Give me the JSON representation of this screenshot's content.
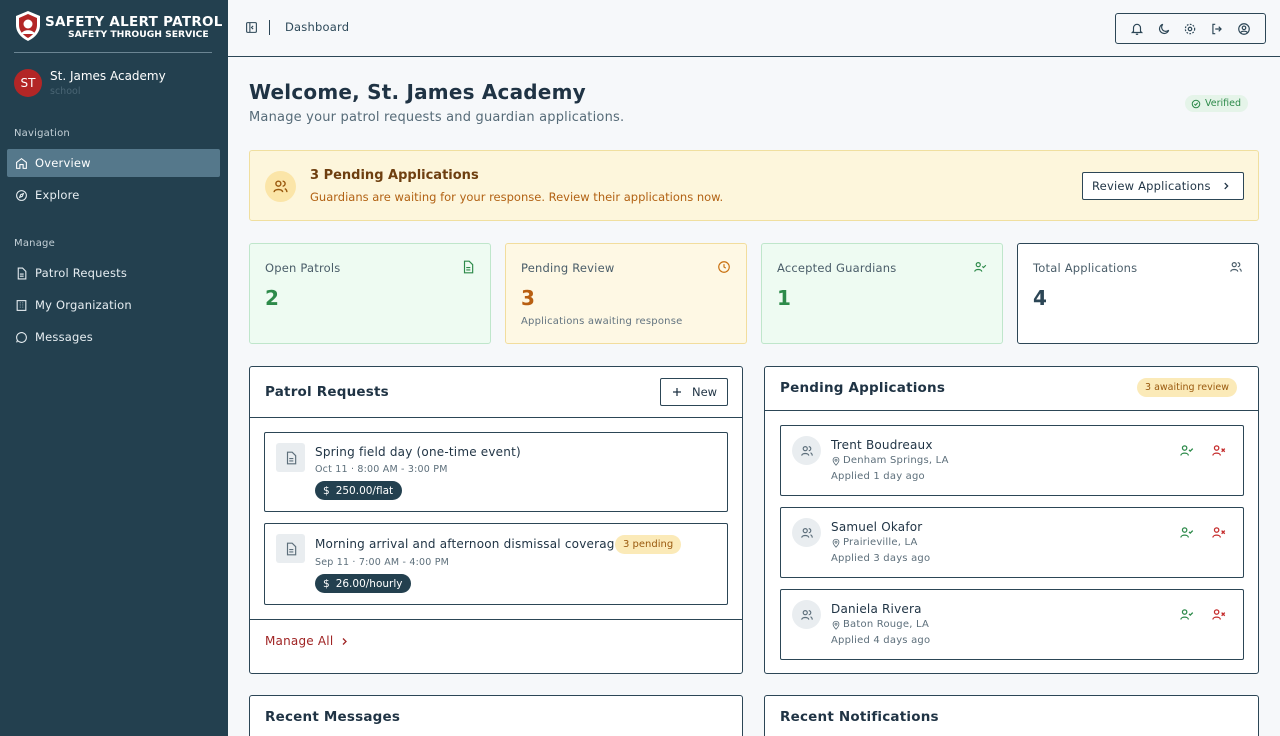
{
  "brand": {
    "title": "SAFETY ALERT PATROL",
    "tagline": "SAFETY THROUGH SERVICE"
  },
  "profile": {
    "initials": "ST",
    "name": "St. James Academy",
    "role": "school"
  },
  "nav": {
    "section1": "Navigation",
    "items1": [
      {
        "label": "Overview",
        "icon": "home-icon",
        "active": true
      },
      {
        "label": "Explore",
        "icon": "compass-icon",
        "active": false
      }
    ],
    "section2": "Manage",
    "items2": [
      {
        "label": "Patrol Requests",
        "icon": "file-text-icon"
      },
      {
        "label": "My Organization",
        "icon": "building-icon"
      },
      {
        "label": "Messages",
        "icon": "message-circle-icon"
      }
    ]
  },
  "topbar": {
    "breadcrumb": "Dashboard",
    "tools": [
      "bell-icon",
      "moon-icon",
      "gear-icon",
      "logout-icon",
      "user-circle-icon"
    ]
  },
  "header": {
    "welcome": "Welcome, St. James Academy",
    "subtitle": "Manage your patrol requests and guardian applications.",
    "badge": "Verified"
  },
  "alert": {
    "title": "3 Pending Applications",
    "text": "Guardians are waiting for your response. Review their applications now.",
    "button": "Review Applications"
  },
  "stats": [
    {
      "label": "Open Patrols",
      "value": "2",
      "sub": "",
      "icon": "file-text-icon",
      "color": "#2d8a4a"
    },
    {
      "label": "Pending Review",
      "value": "3",
      "sub": "Applications awaiting response",
      "icon": "clock-icon",
      "color": "#b85f12"
    },
    {
      "label": "Accepted Guardians",
      "value": "1",
      "sub": "",
      "icon": "user-check-icon",
      "color": "#2d8a4a"
    },
    {
      "label": "Total Applications",
      "value": "4",
      "sub": "",
      "icon": "users-icon",
      "color": "#2c4656"
    }
  ],
  "patrol_requests": {
    "title": "Patrol Requests",
    "new_label": "New",
    "items": [
      {
        "title": "Spring field day (one-time event)",
        "time": "Oct 11 · 8:00 AM - 3:00 PM",
        "price": "250.00/flat",
        "pending": ""
      },
      {
        "title": "Morning arrival and afternoon dismissal coverage",
        "time": "Sep 11 · 7:00 AM - 4:00 PM",
        "price": "26.00/hourly",
        "pending": "3 pending"
      }
    ],
    "manage_all": "Manage All"
  },
  "pending_applications": {
    "title": "Pending Applications",
    "badge": "3 awaiting review",
    "items": [
      {
        "name": "Trent Boudreaux",
        "location": "Denham Springs, LA",
        "applied": "Applied 1 day ago"
      },
      {
        "name": "Samuel Okafor",
        "location": "Prairieville, LA",
        "applied": "Applied 3 days ago"
      },
      {
        "name": "Daniela Rivera",
        "location": "Baton Rouge, LA",
        "applied": "Applied 4 days ago"
      }
    ]
  },
  "recent_messages": {
    "title": "Recent Messages"
  },
  "recent_notifications": {
    "title": "Recent Notifications"
  }
}
